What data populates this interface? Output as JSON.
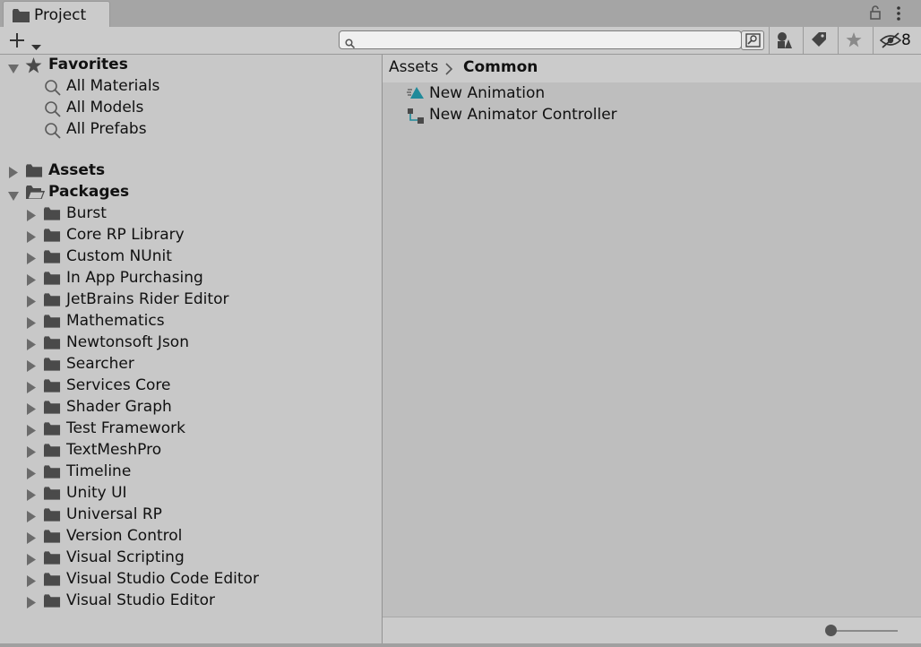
{
  "window": {
    "tab_label": "Project",
    "tab_icon": "folder-icon",
    "lock_icon": "lock-icon",
    "menu_icon": "kebab-menu-icon"
  },
  "toolbar": {
    "add_icon": "plus-dropdown-icon",
    "search": {
      "value": "",
      "placeholder": ""
    },
    "search_new_window_icon": "search-new-window-icon",
    "filter_type_icon": "filter-by-type-icon",
    "filter_label_icon": "filter-by-label-icon",
    "favorite_icon": "save-search-star-icon",
    "hidden_packages_icon": "eye-slash-icon",
    "hidden_packages_count": "8"
  },
  "favorites": {
    "label": "Favorites",
    "items": [
      {
        "label": "All Materials"
      },
      {
        "label": "All Models"
      },
      {
        "label": "All Prefabs"
      }
    ]
  },
  "assets": {
    "label": "Assets"
  },
  "packages": {
    "label": "Packages",
    "items": [
      {
        "label": "Burst"
      },
      {
        "label": "Core RP Library"
      },
      {
        "label": "Custom NUnit"
      },
      {
        "label": "In App Purchasing"
      },
      {
        "label": "JetBrains Rider Editor"
      },
      {
        "label": "Mathematics"
      },
      {
        "label": "Newtonsoft Json"
      },
      {
        "label": "Searcher"
      },
      {
        "label": "Services Core"
      },
      {
        "label": "Shader Graph"
      },
      {
        "label": "Test Framework"
      },
      {
        "label": "TextMeshPro"
      },
      {
        "label": "Timeline"
      },
      {
        "label": "Unity UI"
      },
      {
        "label": "Universal RP"
      },
      {
        "label": "Version Control"
      },
      {
        "label": "Visual Scripting"
      },
      {
        "label": "Visual Studio Code Editor"
      },
      {
        "label": "Visual Studio Editor"
      }
    ]
  },
  "breadcrumb": {
    "root": "Assets",
    "current": "Common"
  },
  "files": [
    {
      "label": "New Animation",
      "icon": "animation-clip-icon"
    },
    {
      "label": "New Animator Controller",
      "icon": "animator-controller-icon"
    }
  ],
  "zoom_slider": {
    "value": 0
  },
  "colors": {
    "panel": "#c8c8c8",
    "content": "#bebebe",
    "toolbar": "#cbcbcb",
    "accent_teal": "#1f8a9a",
    "icon_dark": "#4a4a4a"
  }
}
